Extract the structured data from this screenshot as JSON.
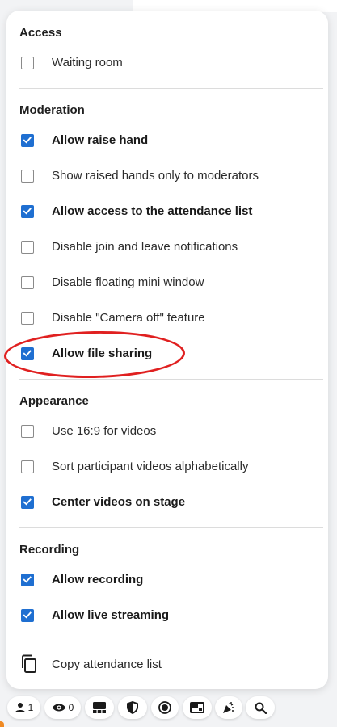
{
  "sections": {
    "access": {
      "title": "Access",
      "items": [
        {
          "label": "Waiting room",
          "checked": false
        }
      ]
    },
    "moderation": {
      "title": "Moderation",
      "items": [
        {
          "label": "Allow raise hand",
          "checked": true
        },
        {
          "label": "Show raised hands only to moderators",
          "checked": false
        },
        {
          "label": "Allow access to the attendance list",
          "checked": true
        },
        {
          "label": "Disable join and leave notifications",
          "checked": false
        },
        {
          "label": "Disable floating mini window",
          "checked": false
        },
        {
          "label": "Disable \"Camera off\" feature",
          "checked": false
        },
        {
          "label": "Allow file sharing",
          "checked": true
        }
      ]
    },
    "appearance": {
      "title": "Appearance",
      "items": [
        {
          "label": "Use 16:9 for videos",
          "checked": false
        },
        {
          "label": "Sort participant videos alphabetically",
          "checked": false
        },
        {
          "label": "Center videos on stage",
          "checked": true
        }
      ]
    },
    "recording": {
      "title": "Recording",
      "items": [
        {
          "label": "Allow recording",
          "checked": true
        },
        {
          "label": "Allow live streaming",
          "checked": true
        }
      ]
    }
  },
  "copy_attendance": {
    "label": "Copy attendance list",
    "icon": "copy-icon"
  },
  "toolbar": {
    "participants_count": "1",
    "viewers_count": "0",
    "items": [
      "participants-icon",
      "eye-icon",
      "layout-icon",
      "shield-icon",
      "record-icon",
      "picture-in-picture-icon",
      "party-popper-icon",
      "search-icon"
    ]
  },
  "colors": {
    "accent": "#1f6fd1",
    "highlight": "#e02020"
  }
}
